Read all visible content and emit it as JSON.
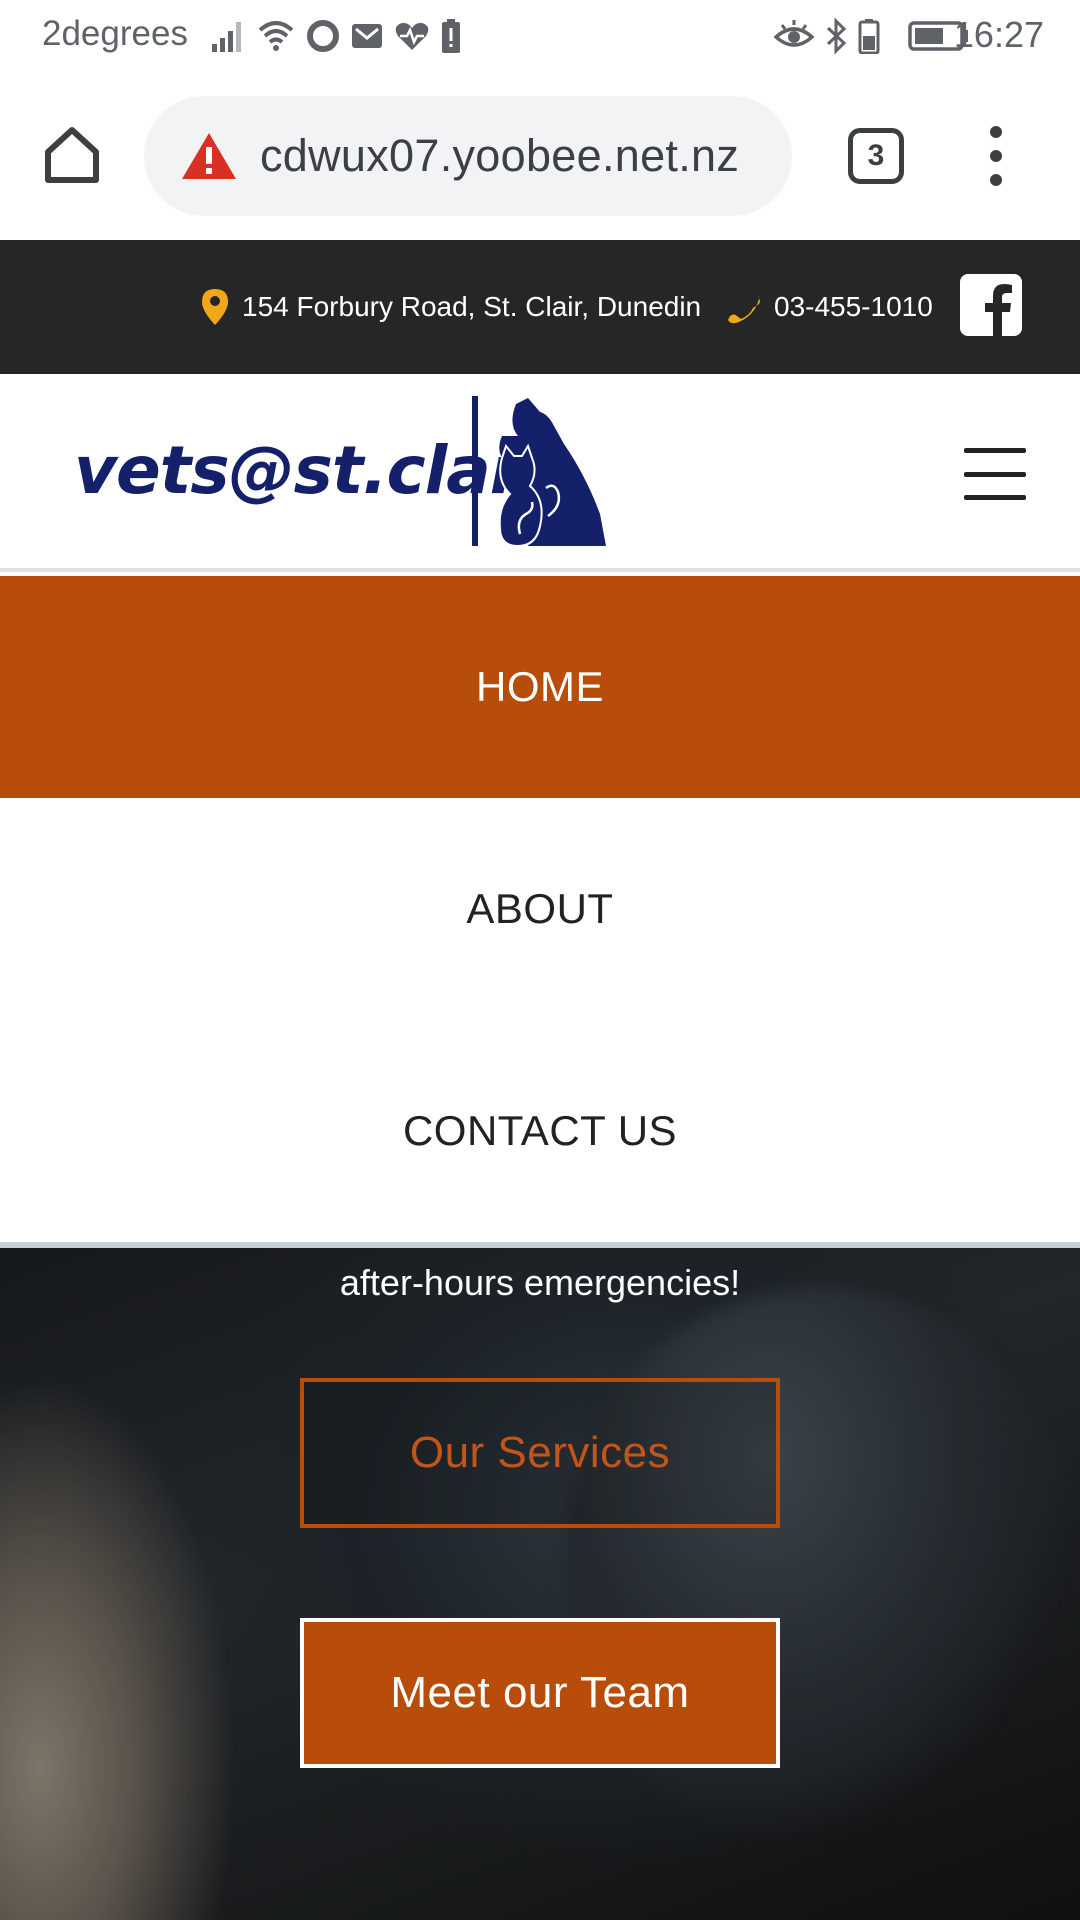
{
  "status_bar": {
    "carrier": "2degrees",
    "time": "16:27",
    "left_icons": [
      "signal-icon",
      "wifi-icon",
      "circle-icon",
      "gmail-icon",
      "heart-rate-icon",
      "battery-alert-icon"
    ],
    "right_icons": [
      "eye-icon",
      "bluetooth-icon",
      "battery-icon"
    ]
  },
  "browser": {
    "url": "cdwux07.yoobee.net.nz",
    "tab_count": "3",
    "security_icon": "warning-triangle-icon"
  },
  "infobar": {
    "address": "154 Forbury Road, St. Clair, Dunedin",
    "phone": "03-455-1010",
    "icon_color": "#f0a818"
  },
  "site": {
    "logo_text": "vets@st.clair",
    "logo_color": "#15206b",
    "accent_color": "#b84c09"
  },
  "nav": {
    "items": [
      {
        "label": "HOME",
        "active": true
      },
      {
        "label": "ABOUT",
        "active": false
      },
      {
        "label": "CONTACT US",
        "active": false
      }
    ]
  },
  "hero": {
    "text": "after-hours emergencies!",
    "services_button": "Our Services",
    "team_button": "Meet our Team"
  }
}
